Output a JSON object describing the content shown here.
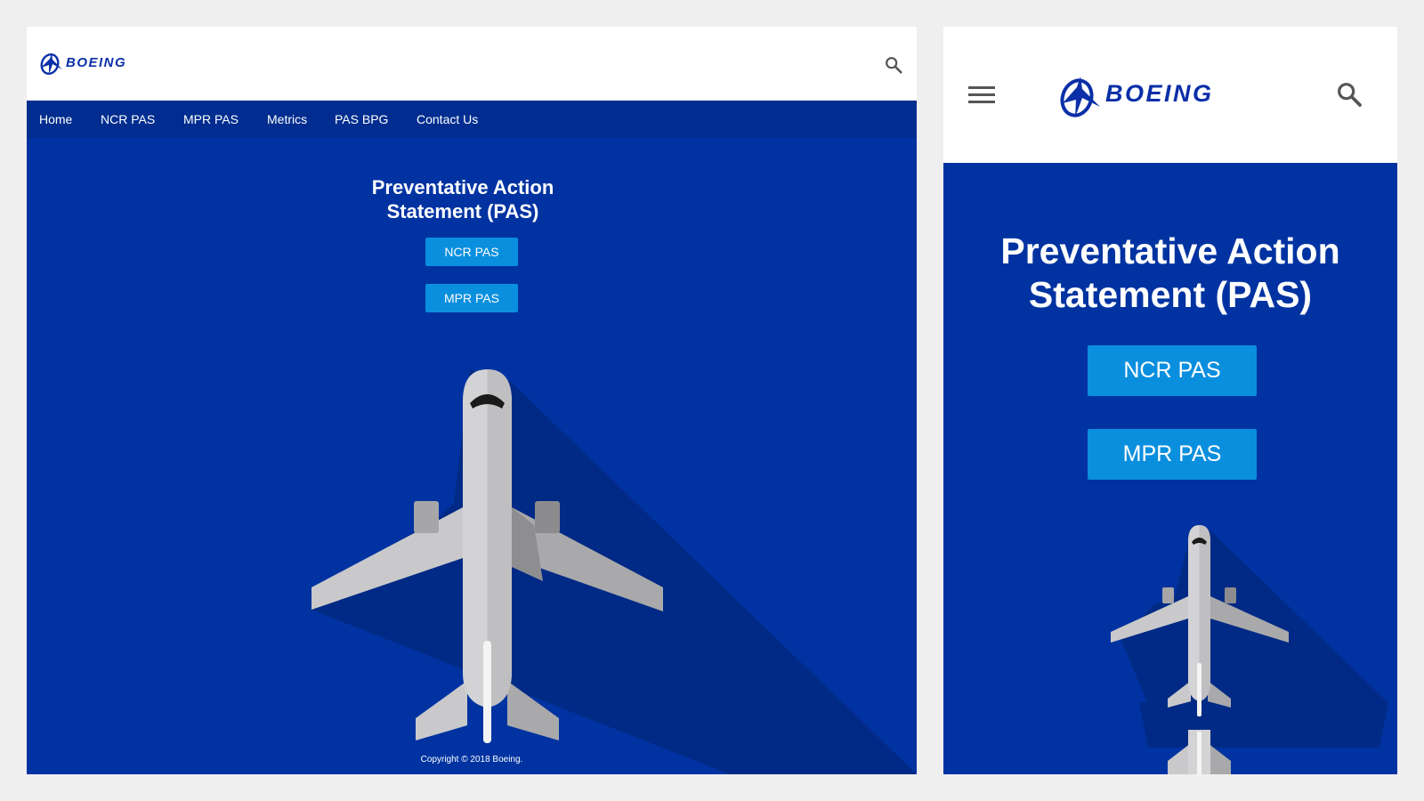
{
  "brand": {
    "name": "BOEING",
    "color": "#0033a1",
    "accent": "#0a8fde"
  },
  "desktop": {
    "nav": [
      {
        "label": "Home"
      },
      {
        "label": "NCR PAS"
      },
      {
        "label": "MPR PAS"
      },
      {
        "label": "Metrics"
      },
      {
        "label": "PAS BPG"
      },
      {
        "label": "Contact Us"
      }
    ],
    "hero": {
      "title_line1": "Preventative Action",
      "title_line2": "Statement (PAS)",
      "buttons": [
        {
          "label": "NCR PAS"
        },
        {
          "label": "MPR PAS"
        }
      ]
    },
    "footer": {
      "copyright": "Copyright © 2018 Boeing."
    },
    "icons": {
      "search": "search-icon",
      "logo": "boeing-logo"
    }
  },
  "mobile": {
    "hero": {
      "title_line1": "Preventative Action",
      "title_line2": "Statement (PAS)",
      "buttons": [
        {
          "label": "NCR PAS"
        },
        {
          "label": "MPR PAS"
        }
      ]
    },
    "icons": {
      "menu": "hamburger-menu-icon",
      "search": "search-icon",
      "logo": "boeing-logo"
    }
  }
}
